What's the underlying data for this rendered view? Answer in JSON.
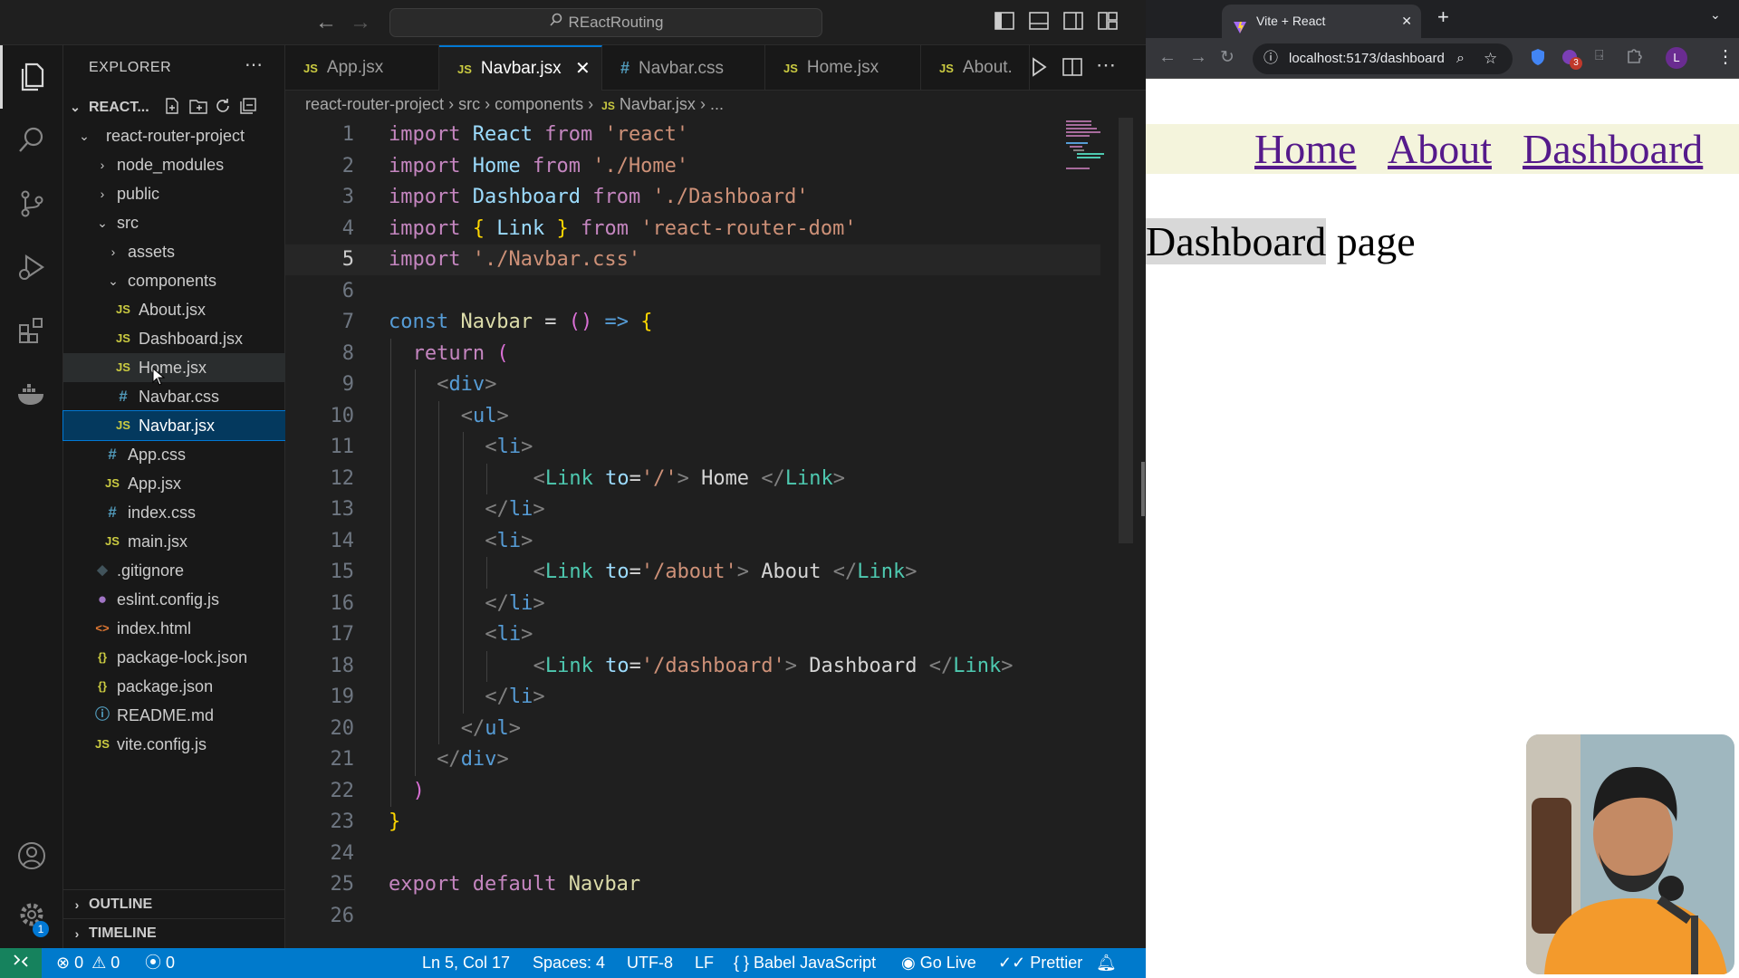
{
  "titlebar": {
    "command_center": "REactRouting",
    "search_icon": "search-icon"
  },
  "explorer": {
    "title": "EXPLORER",
    "project_short": "REACT...",
    "rows": [
      {
        "label": "react-router-project",
        "type": "folder-open"
      },
      {
        "label": "node_modules",
        "type": "folder"
      },
      {
        "label": "public",
        "type": "folder"
      },
      {
        "label": "src",
        "type": "folder-open"
      },
      {
        "label": "assets",
        "type": "folder"
      },
      {
        "label": "components",
        "type": "folder-open"
      },
      {
        "label": "About.jsx",
        "icon": "JS"
      },
      {
        "label": "Dashboard.jsx",
        "icon": "JS"
      },
      {
        "label": "Home.jsx",
        "icon": "JS"
      },
      {
        "label": "Navbar.css",
        "icon": "#"
      },
      {
        "label": "Navbar.jsx",
        "icon": "JS"
      },
      {
        "label": "App.css",
        "icon": "#"
      },
      {
        "label": "App.jsx",
        "icon": "JS"
      },
      {
        "label": "index.css",
        "icon": "#"
      },
      {
        "label": "main.jsx",
        "icon": "JS"
      },
      {
        "label": ".gitignore",
        "icon": "◆"
      },
      {
        "label": "eslint.config.js",
        "icon": "●"
      },
      {
        "label": "index.html",
        "icon": "<>"
      },
      {
        "label": "package-lock.json",
        "icon": "{}"
      },
      {
        "label": "package.json",
        "icon": "{}"
      },
      {
        "label": "README.md",
        "icon": "ⓘ"
      },
      {
        "label": "vite.config.js",
        "icon": "JS"
      }
    ],
    "outline": "OUTLINE",
    "timeline": "TIMELINE"
  },
  "tabs": [
    {
      "label": "App.jsx",
      "icon": "JS"
    },
    {
      "label": "Navbar.jsx",
      "icon": "JS"
    },
    {
      "label": "Navbar.css",
      "icon": "#"
    },
    {
      "label": "Home.jsx",
      "icon": "JS"
    },
    {
      "label": "About.",
      "icon": "JS"
    }
  ],
  "breadcrumb": {
    "p1": "react-router-project",
    "p2": "src",
    "p3": "components",
    "p4": "Navbar.jsx",
    "p5": "...",
    "icon": "JS"
  },
  "code": {
    "numbers": [
      "1",
      "2",
      "3",
      "4",
      "5",
      "6",
      "7",
      "8",
      "9",
      "10",
      "11",
      "12",
      "13",
      "14",
      "15",
      "16",
      "17",
      "18",
      "19",
      "20",
      "21",
      "22",
      "23",
      "24",
      "25",
      "26"
    ],
    "l1": [
      "import",
      " ",
      "React",
      " ",
      "from",
      " ",
      "'react'"
    ],
    "l2": [
      "import",
      " ",
      "Home",
      " ",
      "from",
      " ",
      "'./Home'"
    ],
    "l3": [
      "import",
      " ",
      "Dashboard",
      " ",
      "from",
      " ",
      "'./Dashboard'"
    ],
    "l4": [
      "import",
      " ",
      "{",
      " ",
      "Link",
      " ",
      "}",
      " ",
      "from",
      " ",
      "'react-router-dom'"
    ],
    "l5": [
      "import",
      " ",
      "'./Navbar.css'"
    ],
    "l7": [
      "const",
      " ",
      "Navbar",
      " = ",
      "()",
      " => ",
      "{"
    ],
    "l8": [
      "return",
      " ",
      "("
    ],
    "l9": [
      "<",
      "div",
      ">"
    ],
    "l10": [
      "<",
      "ul",
      ">"
    ],
    "l11": [
      "<",
      "li",
      ">"
    ],
    "l12": [
      "<",
      "Link",
      " ",
      "to",
      "=",
      "'/'",
      ">",
      " Home ",
      "</",
      "Link",
      ">"
    ],
    "l13": [
      "</",
      "li",
      ">"
    ],
    "l14": [
      "<",
      "li",
      ">"
    ],
    "l15": [
      "<",
      "Link",
      " ",
      "to",
      "=",
      "'/about'",
      ">",
      " About ",
      "</",
      "Link",
      ">"
    ],
    "l16": [
      "</",
      "li",
      ">"
    ],
    "l17": [
      "<",
      "li",
      ">"
    ],
    "l18": [
      "<",
      "Link",
      " ",
      "to",
      "=",
      "'/dashboard'",
      ">",
      " Dashboard ",
      "</",
      "Link",
      ">"
    ],
    "l19": [
      "</",
      "li",
      ">"
    ],
    "l20": [
      "</",
      "ul",
      ">"
    ],
    "l21": [
      "</",
      "div",
      ">"
    ],
    "l22": [
      ")"
    ],
    "l23": [
      "}"
    ],
    "l25": [
      "export",
      " ",
      "default",
      " ",
      "Navbar"
    ]
  },
  "statusbar": {
    "errors": "0",
    "warnings": "0",
    "ports": "0",
    "position": "Ln 5, Col 17",
    "spaces": "Spaces: 4",
    "encoding": "UTF-8",
    "eol": "LF",
    "language": "Babel JavaScript",
    "golive": "Go Live",
    "prettier": "Prettier",
    "settings_badge": "1"
  },
  "browser": {
    "tab_title": "Vite + React",
    "url": "localhost:5173/dashboard",
    "extension_badge": "3",
    "profile_initial": "L",
    "nav": {
      "home": "Home",
      "about": "About",
      "dashboard": "Dashboard"
    },
    "heading_word": "Dashboard",
    "heading_rest": " page"
  },
  "colors": {
    "accent": "#007acc",
    "link": "#551a8b",
    "nav_band": "#f4f4dc"
  }
}
